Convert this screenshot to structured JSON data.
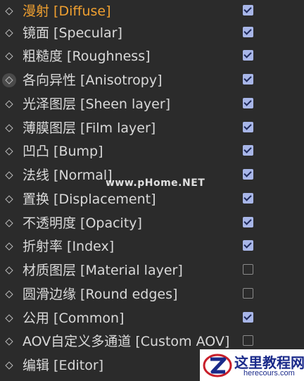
{
  "colors": {
    "background": "#2b2b2b",
    "text": "#d9d9d9",
    "active_text": "#f0a030",
    "checkbox_checked": "#a8b6e8"
  },
  "items": [
    {
      "label": "漫射 [Diffuse]",
      "checked": true,
      "active": true
    },
    {
      "label": "镜面 [Specular]",
      "checked": true
    },
    {
      "label": "粗糙度 [Roughness]",
      "checked": true
    },
    {
      "label": "各向异性 [Anisotropy]",
      "checked": true
    },
    {
      "label": "光泽图层 [Sheen layer]",
      "checked": true
    },
    {
      "label": "薄膜图层 [Film layer]",
      "checked": true
    },
    {
      "label": "凹凸 [Bump]",
      "checked": true
    },
    {
      "label": "法线 [Normal]",
      "checked": true
    },
    {
      "label": "置换 [Displacement]",
      "checked": true
    },
    {
      "label": "不透明度 [Opacity]",
      "checked": true
    },
    {
      "label": "折射率 [Index]",
      "checked": true
    },
    {
      "label": "材质图层 [Material layer]",
      "checked": false
    },
    {
      "label": "圆滑边缘 [Round edges]",
      "checked": false
    },
    {
      "label": "公用 [Common]",
      "checked": true
    },
    {
      "label": "AOV自定义多通道 [Custom AOV]",
      "checked": false
    },
    {
      "label": "编辑 [Editor]",
      "checked": null
    }
  ],
  "watermark": "www.pHome.NET",
  "logo": {
    "cn": "这里教程网",
    "en": "herecours.com"
  }
}
